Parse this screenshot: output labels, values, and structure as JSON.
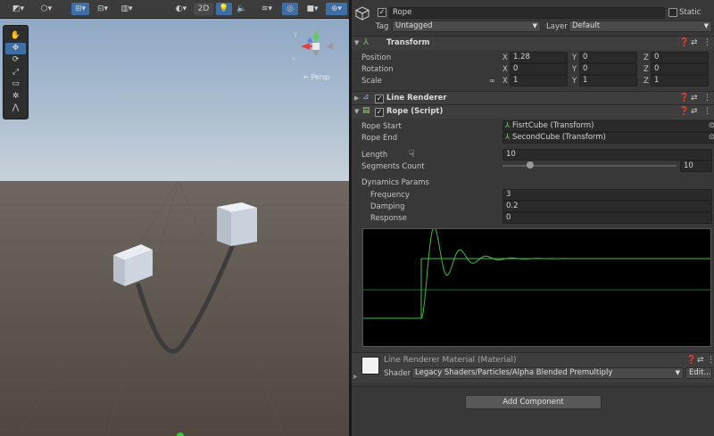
{
  "scene": {
    "toolbar": {
      "mode_2d": "2D"
    },
    "tools": [
      "hand-tool-icon",
      "move-tool-icon",
      "rotate-tool-icon",
      "scale-tool-icon",
      "rect-tool-icon",
      "transform-tool-icon",
      "custom-tool-icon"
    ],
    "gizmo": {
      "x_label": "x",
      "y_label": "y",
      "persp_label": "← Persp"
    }
  },
  "inspector": {
    "object": {
      "name": "Rope",
      "static_label": "Static",
      "tag_label": "Tag",
      "tag_value": "Untagged",
      "layer_label": "Layer",
      "layer_value": "Default"
    },
    "transform": {
      "title": "Transform",
      "position_label": "Position",
      "rotation_label": "Rotation",
      "scale_label": "Scale",
      "axis_x": "X",
      "axis_y": "Y",
      "axis_z": "Z",
      "position": {
        "x": "1.28",
        "y": "0",
        "z": "0"
      },
      "rotation": {
        "x": "0",
        "y": "0",
        "z": "0"
      },
      "scale": {
        "x": "1",
        "y": "1",
        "z": "1"
      }
    },
    "line_renderer": {
      "title": "Line Renderer"
    },
    "rope_script": {
      "title": "Rope (Script)",
      "rope_start_label": "Rope Start",
      "rope_start_value": "FisrtCube (Transform)",
      "rope_end_label": "Rope End",
      "rope_end_value": "SecondCube (Transform)",
      "length_label": "Length",
      "length_value": "10",
      "segments_label": "Segments Count",
      "segments_value": "10",
      "dynamics_label": "Dynamics Params",
      "frequency_label": "Frequency",
      "frequency_value": "3",
      "damping_label": "Damping",
      "damping_value": "0.2",
      "response_label": "Response",
      "response_value": "0"
    },
    "material": {
      "title": "Line Renderer Material (Material)",
      "shader_label": "Shader",
      "shader_value": "Legacy Shaders/Particles/Alpha Blended Premultiply",
      "edit_label": "Edit..."
    },
    "add_component_label": "Add Component"
  },
  "colors": {
    "accent": "#3d6fa6",
    "graph_line": "#3fbf3f",
    "panel": "#383838"
  }
}
